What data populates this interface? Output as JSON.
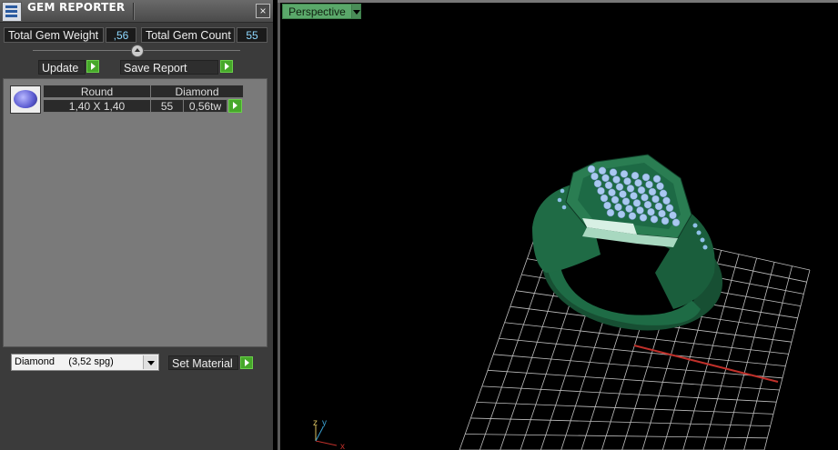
{
  "window": {
    "title": "GEM REPORTER",
    "close_symbol": "×"
  },
  "summary": {
    "weight_label": "Total Gem Weight",
    "weight_value": ",56",
    "count_label": "Total Gem Count",
    "count_value": "55"
  },
  "actions": {
    "update_label": "Update",
    "save_report_label": "Save Report"
  },
  "gem_table": {
    "columns": [
      "Round",
      "Diamond"
    ],
    "rows": [
      {
        "size": "1,40 X 1,40",
        "count": "55",
        "weight": "0,56tw"
      }
    ]
  },
  "material": {
    "selected": "Diamond     (3,52 spg)",
    "set_label": "Set Material"
  },
  "viewport": {
    "view_label": "Perspective",
    "axis_labels": {
      "z": "z",
      "y": "y",
      "x": "x"
    }
  },
  "colors": {
    "ring_green": "#1f6b45",
    "gem_blue": "#a9c8f0",
    "grid": "#bfbfbf",
    "axis_x": "#c0302a",
    "axis_z": "#2a8ec8",
    "play_green": "#46a82a"
  }
}
